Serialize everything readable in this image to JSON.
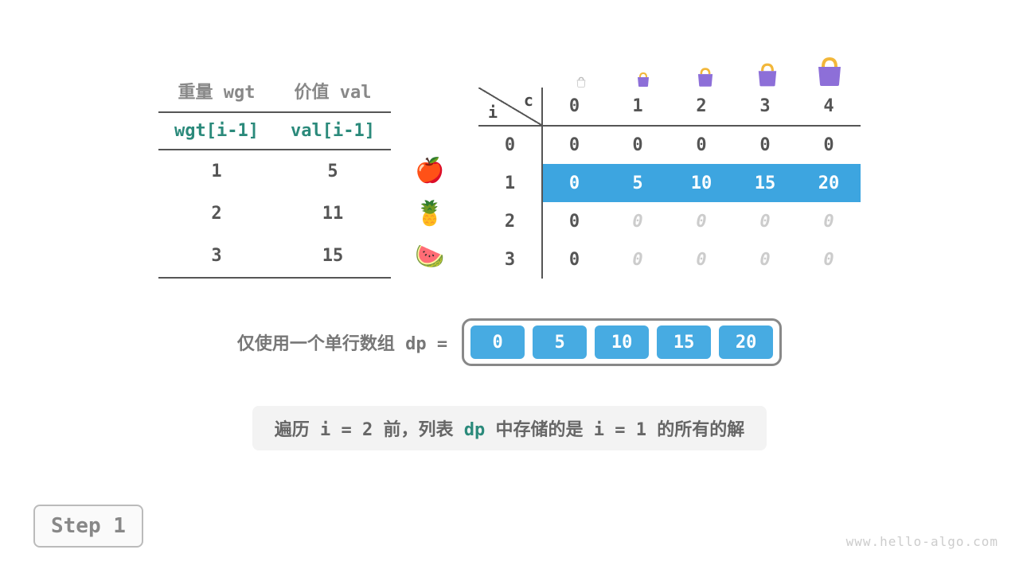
{
  "chart_data": {
    "type": "table",
    "title": "完全背包 dp 单行数组 Step 1",
    "items": [
      {
        "weight": 1,
        "value": 5,
        "icon": "apple"
      },
      {
        "weight": 2,
        "value": 11,
        "icon": "pineapple"
      },
      {
        "weight": 3,
        "value": 15,
        "icon": "watermelon"
      }
    ],
    "capacities": [
      0,
      1,
      2,
      3,
      4
    ],
    "dp_full": [
      [
        0,
        0,
        0,
        0,
        0
      ],
      [
        0,
        5,
        10,
        15,
        20
      ],
      [
        0,
        0,
        0,
        0,
        0
      ],
      [
        0,
        0,
        0,
        0,
        0
      ]
    ],
    "highlight_row": 1,
    "faded_rows": [
      2,
      3
    ],
    "dp_single": [
      0,
      5,
      10,
      15,
      20
    ]
  },
  "items_header": {
    "wgt": "重量 wgt",
    "val": "价值 val"
  },
  "items_subheader": {
    "wgt": "wgt[i-1]",
    "val": "val[i-1]"
  },
  "corner": {
    "c": "c",
    "i": "i"
  },
  "row_index": [
    "0",
    "1",
    "2",
    "3"
  ],
  "dp_label": "仅使用一个单行数组 dp =",
  "caption": {
    "pre": "遍历 i = 2 前，列表 ",
    "hl": "dp",
    "post": " 中存储的是 i = 1 的所有的解"
  },
  "step_label": "Step 1",
  "watermark": "www.hello-algo.com",
  "bag_sizes": [
    14,
    20,
    26,
    32,
    40
  ],
  "colors": {
    "accent": "#3da5e0",
    "teal": "#2b8a7b",
    "purple": "#8d6fd8",
    "handle": "#f2b73a"
  }
}
